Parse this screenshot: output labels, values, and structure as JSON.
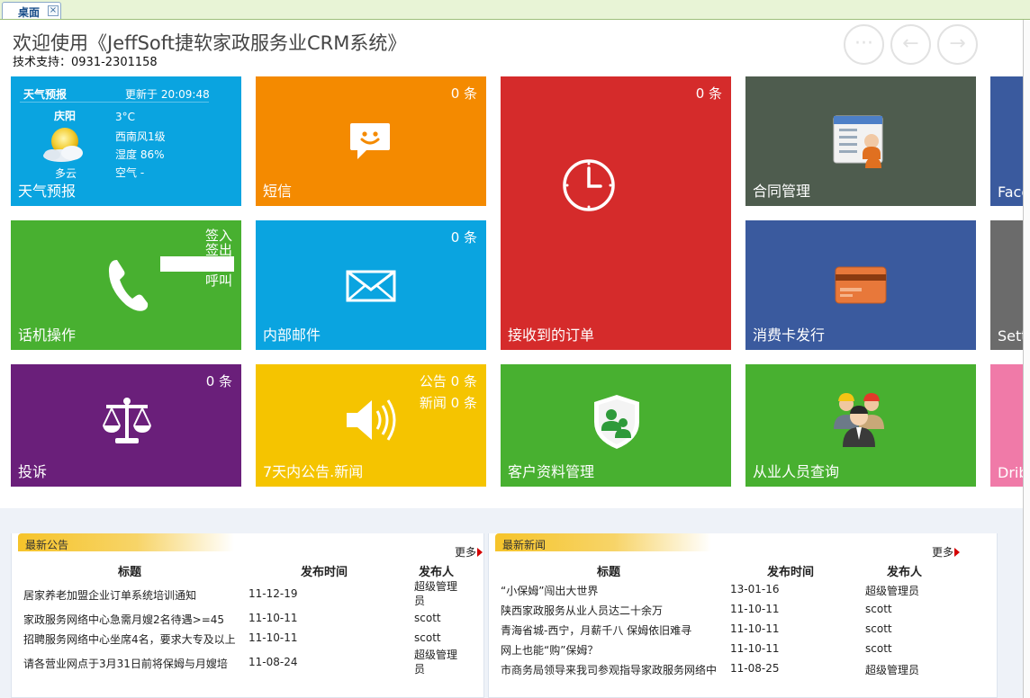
{
  "tab": {
    "label": "桌面",
    "close": "×"
  },
  "header": {
    "welcome": "欢迎使用《JeffSoft捷软家政服务业CRM系统》",
    "support": "技术支持：0931-2301158",
    "nav": {
      "more": "···",
      "prev": "←",
      "next": "→"
    }
  },
  "weather": {
    "title": "天气预报",
    "updated": "更新于 20:09:48",
    "city": "庆阳",
    "temp": "3°C",
    "wind": "西南风1级",
    "humidity": "湿度 86%",
    "air": "空气  -",
    "desc": "多云",
    "label": "天气预报",
    "icon": "partly-cloudy-icon"
  },
  "tiles": {
    "sms": {
      "label": "短信",
      "count": "0 条",
      "icon": "chat-bubble-icon",
      "color": "#f48a00"
    },
    "orders": {
      "label": "接收到的订单",
      "count": "0 条",
      "icon": "clock-icon",
      "color": "#d52b2b"
    },
    "contract": {
      "label": "合同管理",
      "icon": "contract-card-icon",
      "color": "#4e5c4e"
    },
    "face": {
      "label": "Face",
      "color": "#3a5a9e"
    },
    "phone": {
      "label": "话机操作",
      "signin": "签入",
      "signout": "签出",
      "call": "呼叫",
      "icon": "phone-icon",
      "color": "#48b030"
    },
    "mail": {
      "label": "内部邮件",
      "count": "0 条",
      "icon": "envelope-icon",
      "color": "#0aa4e0"
    },
    "card": {
      "label": "消费卡发行",
      "icon": "credit-card-icon",
      "color": "#3a5a9e"
    },
    "settings": {
      "label": "Setti",
      "color": "#6b6b6b"
    },
    "complaint": {
      "label": "投诉",
      "count": "0 条",
      "icon": "scales-icon",
      "color": "#6a1f7a"
    },
    "notice": {
      "label": "7天内公告.新闻",
      "notice_count": "公告 0 条",
      "news_count": "新闻 0 条",
      "icon": "speaker-icon",
      "color": "#f5c400"
    },
    "customer": {
      "label": "客户资料管理",
      "icon": "customer-shield-icon",
      "color": "#48b030"
    },
    "staff": {
      "label": "从业人员查询",
      "icon": "workers-icon",
      "color": "#48b030"
    },
    "drib": {
      "label": "Drib",
      "color": "#f07aa8"
    }
  },
  "announcements": {
    "title": "最新公告",
    "more": "更多",
    "columns": [
      "标题",
      "发布时间",
      "发布人"
    ],
    "rows": [
      {
        "title": "居家养老加盟企业订单系统培训通知",
        "date": "11-12-19",
        "author": "超级管理员"
      },
      {
        "title": "家政服务网络中心急需月嫂2名待遇>=45",
        "date": "11-10-11",
        "author": "scott"
      },
      {
        "title": "招聘服务网络中心坐席4名，要求大专及以上",
        "date": "11-10-11",
        "author": "scott"
      },
      {
        "title": "请各营业网点于3月31日前将保姆与月嫂培",
        "date": "11-08-24",
        "author": "超级管理员"
      }
    ]
  },
  "news": {
    "title": "最新新闻",
    "more": "更多",
    "columns": [
      "标题",
      "发布时间",
      "发布人"
    ],
    "rows": [
      {
        "title": "“小保姆”闯出大世界",
        "date": "13-01-16",
        "author": "超级管理员"
      },
      {
        "title": "陕西家政服务从业人员达二十余万",
        "date": "11-10-11",
        "author": "scott"
      },
      {
        "title": "青海省城-西宁，月薪千八 保姆依旧难寻",
        "date": "11-10-11",
        "author": "scott"
      },
      {
        "title": "网上也能“购”保姆？",
        "date": "11-10-11",
        "author": "scott"
      },
      {
        "title": "市商务局领导来我司参观指导家政服务网络中",
        "date": "11-08-25",
        "author": "超级管理员"
      }
    ]
  }
}
